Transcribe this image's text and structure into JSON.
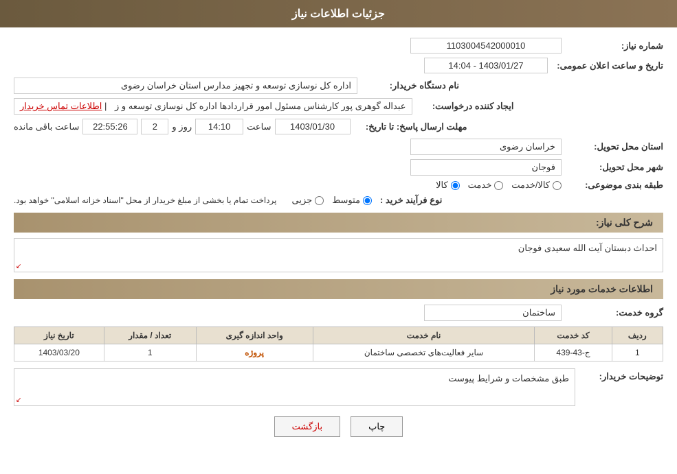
{
  "header": {
    "title": "جزئیات اطلاعات نیاز"
  },
  "fields": {
    "request_number_label": "شماره نیاز:",
    "request_number_value": "1103004542000010",
    "buyer_org_label": "نام دستگاه خریدار:",
    "buyer_org_value": "اداره کل نوسازی  توسعه و تجهیز مدارس استان خراسان رضوی",
    "requester_label": "ایجاد کننده درخواست:",
    "requester_value": "عبداله گوهری پور کارشناس مسئول امور قراردادها  اداره کل نوسازی  توسعه و ز",
    "requester_link": "اطلاعات تماس خریدار",
    "response_date_label": "مهلت ارسال پاسخ: تا تاریخ:",
    "response_date": "1403/01/30",
    "response_time_label": "ساعت",
    "response_time": "14:10",
    "response_days_label": "روز و",
    "response_days": "2",
    "response_remaining_label": "ساعت باقی مانده",
    "response_remaining": "22:55:26",
    "province_label": "استان محل تحویل:",
    "province_value": "خراسان رضوی",
    "city_label": "شهر محل تحویل:",
    "city_value": "فوجان",
    "category_label": "طبقه بندی موضوعی:",
    "category_options": [
      "کالا",
      "خدمت",
      "کالا/خدمت"
    ],
    "category_selected": "کالا",
    "purchase_type_label": "نوع فرآیند خرید :",
    "purchase_type_options": [
      "جزیی",
      "متوسط"
    ],
    "purchase_type_selected": "متوسط",
    "purchase_note": "پرداخت تمام یا بخشی از مبلغ خریدار از محل \"اسناد خزانه اسلامی\" خواهد بود.",
    "announce_datetime_label": "تاریخ و ساعت اعلان عمومی:",
    "announce_datetime_value": "1403/01/27 - 14:04",
    "description_label": "شرح کلی نیاز:",
    "description_value": "احداث دبستان آیت الله سعیدی فوجان",
    "services_section_title": "اطلاعات خدمات مورد نیاز",
    "service_group_label": "گروه خدمت:",
    "service_group_value": "ساختمان",
    "table": {
      "headers": [
        "ردیف",
        "کد خدمت",
        "نام خدمت",
        "واحد اندازه گیری",
        "تعداد / مقدار",
        "تاریخ نیاز"
      ],
      "rows": [
        {
          "row": "1",
          "code": "ج-43-439",
          "name": "سایر فعالیت‌های تخصصی ساختمان",
          "unit": "پروژه",
          "quantity": "1",
          "date": "1403/03/20"
        }
      ]
    },
    "buyer_desc_label": "توضیحات خریدار:",
    "buyer_desc_value": "طبق مشخصات و شرایط پیوست"
  },
  "buttons": {
    "print_label": "چاپ",
    "back_label": "بازگشت"
  }
}
